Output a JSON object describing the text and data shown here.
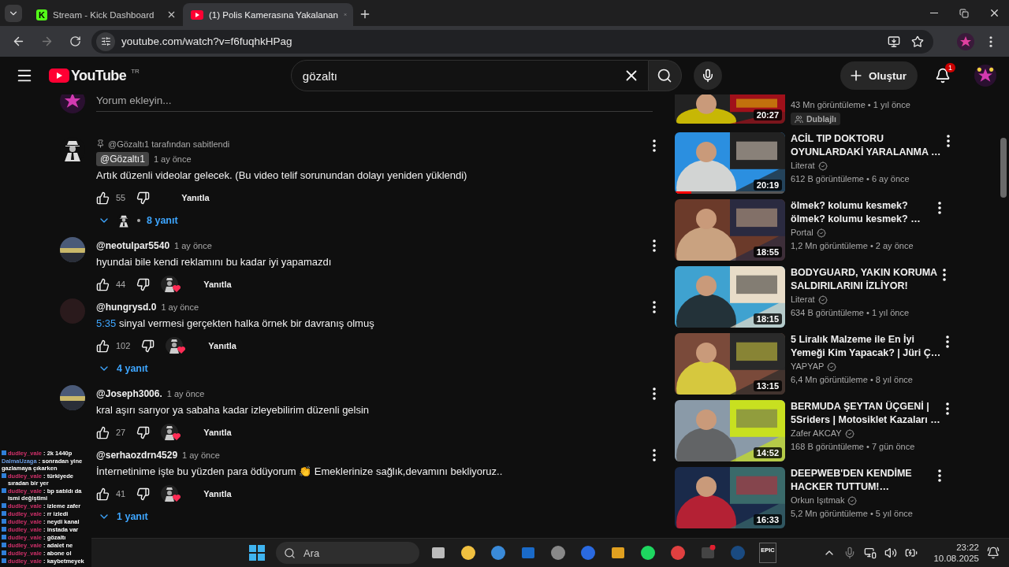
{
  "browser": {
    "tabs": [
      {
        "title": "Stream - Kick Dashboard",
        "favicon": {
          "kind": "letter",
          "letter": "K"
        },
        "selected": false
      },
      {
        "title": "(1) Polis Kamerasına Yakalanan",
        "favicon": {
          "kind": "play"
        },
        "selected": true
      }
    ],
    "url": "youtube.com/watch?v=f6fuqhkHPag"
  },
  "header": {
    "logo": "YouTube",
    "region": "TR",
    "search": "gözaltı",
    "create": "Oluştur",
    "notifications": "1"
  },
  "comment_box": {
    "placeholder": "Yorum ekleyin..."
  },
  "comments": [
    {
      "avatar": {
        "kind": "silhouette"
      },
      "pinned_by": "@Gözaltı1 tarafından sabitlendi",
      "author": "@Gözaltı1",
      "author_chip": true,
      "time": "1 ay önce",
      "text": "Artık düzenli videolar gelecek. (Bu video telif sorunundan dolayı yeniden yüklendi)",
      "likes": "55",
      "reply": "Yanıtla",
      "creator_heart": false,
      "replies": "8 yanıt",
      "replies_avatar": true
    },
    {
      "author": "@neotulpar5540",
      "author_chip": false,
      "time": "1 ay önce",
      "text": "hyundai bile kendi reklamını bu kadar iyi yapamazdı",
      "likes": "44",
      "reply": "Yanıtla",
      "creator_heart": true
    },
    {
      "avatar": {
        "kind": "dark"
      },
      "author": "@hungrysd.0",
      "author_chip": false,
      "time": "1 ay önce",
      "timestamp": "5:35",
      "text": "sinyal vermesi gerçekten halka örnek bir davranış olmuş",
      "likes": "102",
      "reply": "Yanıtla",
      "creator_heart": true,
      "replies": "4 yanıt",
      "replies_avatar": false
    },
    {
      "author": "@Joseph3006.",
      "author_chip": false,
      "time": "1 ay önce",
      "text": "kral aşırı sarıyor ya sabaha kadar izleyebilirim düzenli gelsin",
      "likes": "27",
      "reply": "Yanıtla",
      "creator_heart": true
    },
    {
      "author": "@serhaozdrn4529",
      "author_chip": false,
      "time": "1 ay önce",
      "text": "İnternetinime işte bu yüzden para ödüyorum 👏 Emeklerinize sağlık,devamını bekliyoruz..",
      "likes": "41",
      "reply": "Yanıtla",
      "creator_heart": true,
      "replies": "1 yanıt",
      "replies_avatar": false
    }
  ],
  "recommendations": [
    {
      "duration": "20:27",
      "stats": "43 Mn görüntüleme • 1 yıl önce",
      "badge": "Dublajlı"
    },
    {
      "title_lines": [
        "ACİL TIP DOKTORU",
        "OYUNLARDAKİ YARALANMA …"
      ],
      "channel": "Literat",
      "verified": true,
      "stats": "612 B görüntüleme • 6 ay önce",
      "duration": "20:19",
      "level": 0.15
    },
    {
      "title_lines": [
        "ölmek? kolumu kesmek?",
        "ölmek? kolumu kesmek? …"
      ],
      "channel": "Portal",
      "verified": true,
      "stats": "1,2 Mn görüntüleme • 2 ay önce",
      "duration": "18:55"
    },
    {
      "title_lines": [
        "BODYGUARD, YAKIN KORUMA",
        "SALDIRILARINI İZLİYOR!"
      ],
      "channel": "Literat",
      "verified": true,
      "stats": "634 B görüntüleme • 1 yıl önce",
      "duration": "18:15"
    },
    {
      "title_lines": [
        "5 Liralık Malzeme ile En İyi",
        "Yemeği Kim Yapacak? | Jüri Ç…"
      ],
      "channel": "YAPYAP",
      "verified": true,
      "stats": "6,4 Mn görüntüleme • 8 yıl önce",
      "duration": "13:15"
    },
    {
      "title_lines": [
        "BERMUDA ŞEYTAN ÜÇGENİ |",
        "5Sriders | Motosiklet Kazaları …"
      ],
      "channel": "Zafer AKCAY",
      "verified": true,
      "stats": "168 B görüntüleme • 7 gün önce",
      "duration": "14:52"
    },
    {
      "title_lines": [
        "DEEPWEB'DEN KENDİME",
        "HACKER TUTTUM!…"
      ],
      "channel": "Orkun Işıtmak",
      "verified": true,
      "stats": "5,2 Mn görüntüleme • 5 yıl önce",
      "duration": "16:33"
    }
  ],
  "chat": [
    {
      "user": "dudley_vale",
      "color": "#d0306a",
      "badges": true,
      "message": ": 2k 1440p"
    },
    {
      "user": "DalmaUzaga",
      "color": "#6a9be0",
      "badges": false,
      "message": ": sonradan yine gazlamaya çıkarken"
    },
    {
      "user": "dudley_vale",
      "color": "#d0306a",
      "badges": true,
      "message": ": türkiyede sıradan bir yer"
    },
    {
      "user": "dudley_vale",
      "color": "#d0306a",
      "badges": true,
      "message": ": bp satıldı da ismi değiştimi"
    },
    {
      "user": "dudley_vale",
      "color": "#d0306a",
      "badges": true,
      "message": ": izleme zafer"
    },
    {
      "user": "dudley_vale",
      "color": "#d0306a",
      "badges": true,
      "message": ": rr izledi"
    },
    {
      "user": "dudley_vale",
      "color": "#d0306a",
      "badges": true,
      "message": ": neydi kanal"
    },
    {
      "user": "dudley_vale",
      "color": "#d0306a",
      "badges": true,
      "message": ": instada var"
    },
    {
      "user": "dudley_vale",
      "color": "#d0306a",
      "badges": true,
      "message": ": gözaltı"
    },
    {
      "user": "dudley_vale",
      "color": "#d0306a",
      "badges": true,
      "message": ": adalet ne"
    },
    {
      "user": "dudley_vale",
      "color": "#d0306a",
      "badges": true,
      "message": ": abone ol"
    },
    {
      "user": "dudley_vale",
      "color": "#d0306a",
      "badges": true,
      "message": ": kaybetmeyek"
    }
  ],
  "taskbar": {
    "search_placeholder": "Ara",
    "epic_label": "EPIC",
    "time": "23:22",
    "date": "10.08.2025"
  }
}
